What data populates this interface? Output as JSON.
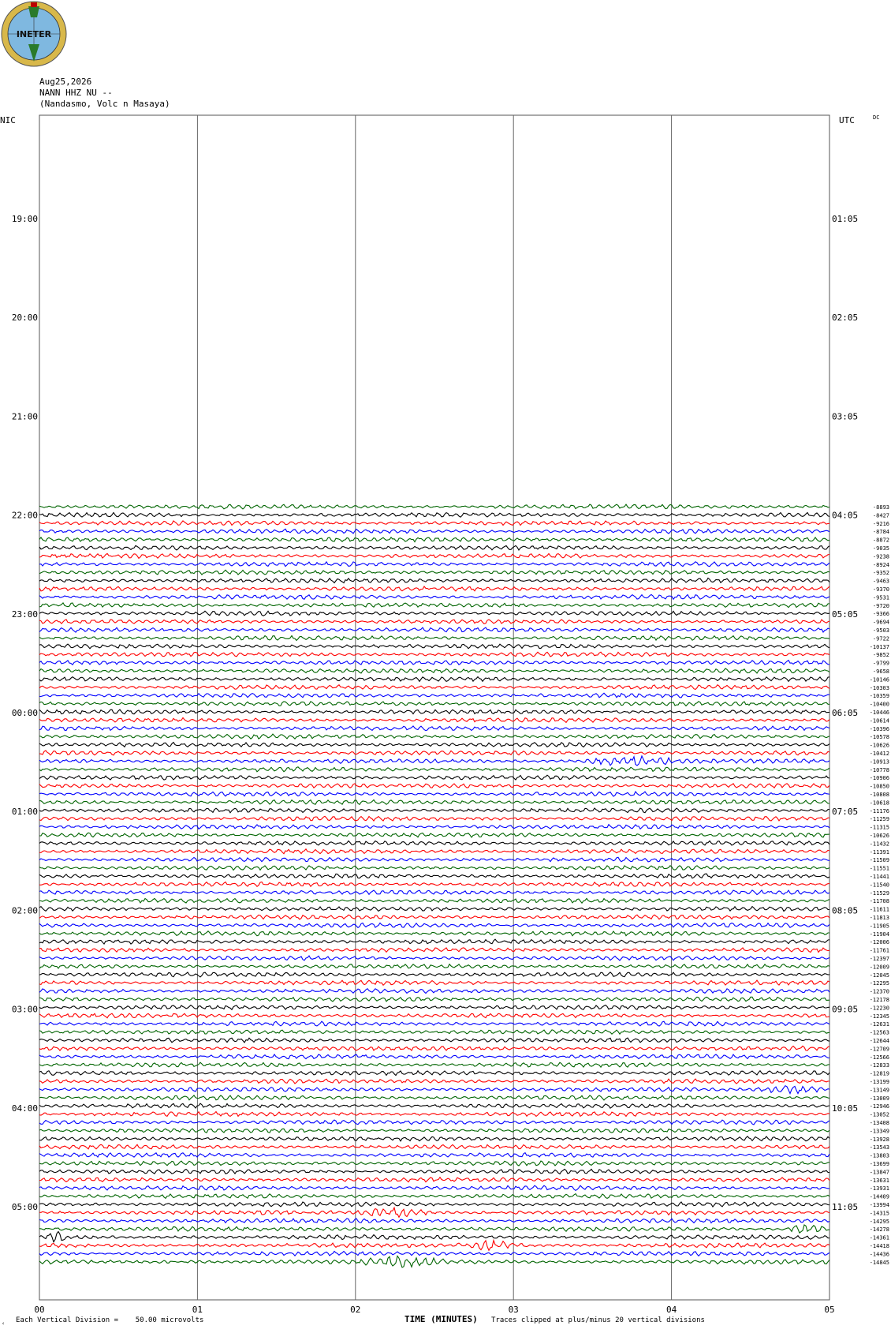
{
  "header": {
    "date": "Aug25,2026",
    "station": "NANN HHZ NU --",
    "location": "(Nandasmo, Volc n Masaya)",
    "left_zone": "NIC",
    "right_zone": "UTC",
    "dc_label": "DC"
  },
  "logo": {
    "text": "INETER"
  },
  "chart_data": {
    "type": "line",
    "xlabel": "TIME (MINUTES)",
    "x_ticks": [
      "00",
      "01",
      "02",
      "03",
      "04",
      "05"
    ],
    "x_range": [
      0,
      5
    ],
    "left_time_labels": [
      "19:00",
      "20:00",
      "21:00",
      "22:00",
      "23:00",
      "00:00",
      "01:00",
      "02:00",
      "03:00",
      "04:00",
      "05:00"
    ],
    "right_time_labels": [
      "01:05",
      "02:05",
      "03:05",
      "04:05",
      "05:05",
      "06:05",
      "07:05",
      "08:05",
      "09:05",
      "10:05",
      "11:05"
    ],
    "trace_colors": [
      "#006400",
      "#000000",
      "#ff0000",
      "#0000ff"
    ],
    "trace_offsets": [
      "-8893",
      "-8427",
      "-9216",
      "-8784",
      "-8872",
      "-9035",
      "-9238",
      "-8924",
      "-9352",
      "-9463",
      "-9370",
      "-9531",
      "-9720",
      "-9366",
      "-9694",
      "-9503",
      "-9722",
      "-10137",
      "-9852",
      "-9799",
      "-9658",
      "-10146",
      "-10303",
      "-10359",
      "-10400",
      "-10446",
      "-10614",
      "-10396",
      "-10578",
      "-10626",
      "-10412",
      "-10913",
      "-10778",
      "-10906",
      "-10850",
      "-10808",
      "-10618",
      "-11176",
      "-11259",
      "-11315",
      "-10626",
      "-11432",
      "-11391",
      "-11509",
      "-11551",
      "-11441",
      "-11540",
      "-11529",
      "-11708",
      "-11611",
      "-11813",
      "-11905",
      "-11904",
      "-12006",
      "-11761",
      "-12397",
      "-12009",
      "-12045",
      "-12295",
      "-12370",
      "-12178",
      "-12230",
      "-12345",
      "-12631",
      "-12563",
      "-12644",
      "-12709",
      "-12566",
      "-12833",
      "-12819",
      "-13199",
      "-13149",
      "-13009",
      "-12946",
      "-13052",
      "-13408",
      "-13349",
      "-13928",
      "-13543",
      "-13803",
      "-13699",
      "-13847",
      "-13631",
      "-13931",
      "-14409",
      "-13994",
      "-14315",
      "-14295",
      "-14278",
      "-14361",
      "-14418",
      "-14436",
      "-14845"
    ],
    "events": [
      {
        "trace": 31,
        "minute_start": 3.4,
        "minute_end": 4.1
      },
      {
        "trace": 71,
        "minute_start": 4.5,
        "minute_end": 5.0
      },
      {
        "trace": 86,
        "minute_start": 2.0,
        "minute_end": 2.5
      },
      {
        "trace": 88,
        "minute_start": 4.7,
        "minute_end": 5.0
      },
      {
        "trace": 89,
        "minute_start": 0.0,
        "minute_end": 0.2
      },
      {
        "trace": 90,
        "minute_start": 2.6,
        "minute_end": 3.1
      },
      {
        "trace": 92,
        "minute_start": 2.0,
        "minute_end": 2.6
      }
    ],
    "grid": true
  },
  "footer": {
    "vertical_division": "Each Vertical Division =",
    "microvolts": "50.00 microvolts",
    "clip_note": "Traces clipped at plus/minus 20 vertical divisions",
    "corner_mark": "‹"
  }
}
